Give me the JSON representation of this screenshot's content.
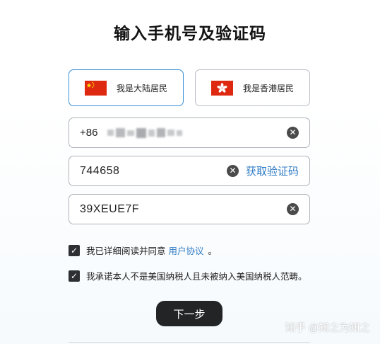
{
  "title": "输入手机号及验证码",
  "residency": {
    "mainland": {
      "label": "我是大陆居民",
      "icon": "china-flag-icon",
      "selected": true
    },
    "hongkong": {
      "label": "我是香港居民",
      "icon": "hongkong-flag-icon",
      "selected": false
    }
  },
  "phone": {
    "prefix": "+86",
    "icon": "clear-icon"
  },
  "sms_code": {
    "value": "744658",
    "get_code_label": "获取验证码",
    "icon": "clear-icon"
  },
  "captcha": {
    "value": "39XEUE7F",
    "icon": "clear-icon"
  },
  "agreements": {
    "terms": {
      "text": "我已详细阅读并同意",
      "link": "用户协议",
      "suffix": "。",
      "checked": true
    },
    "tax": {
      "text": "我承诺本人不是美国纳税人且未被纳入美国纳税人范畴。",
      "checked": true
    }
  },
  "next_label": "下一步",
  "watermark": "知乎 @知之为知之",
  "colors": {
    "accent": "#3a8fd6",
    "link": "#2e7bc5",
    "button": "#222426"
  }
}
